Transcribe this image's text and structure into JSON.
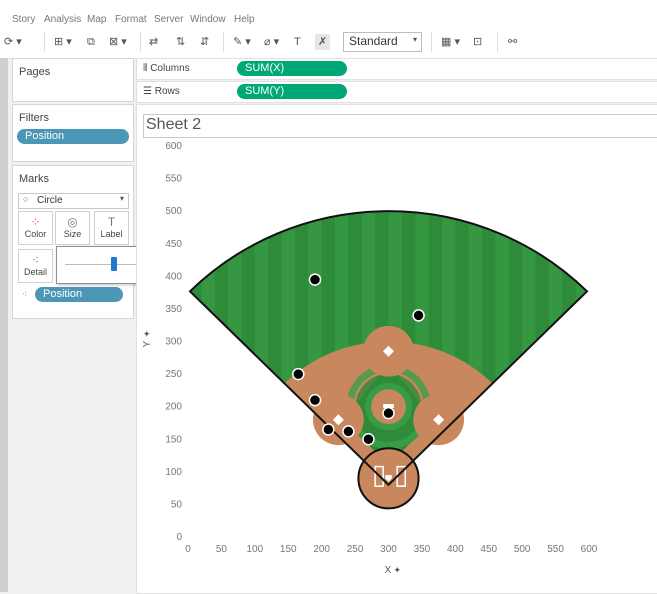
{
  "menu": [
    "Story",
    "Analysis",
    "Map",
    "Format",
    "Server",
    "Window",
    "Help"
  ],
  "toolbar": {
    "fit_select": "Standard"
  },
  "pages": {
    "title": "Pages"
  },
  "filters": {
    "title": "Filters",
    "pill": "Position"
  },
  "marks": {
    "title": "Marks",
    "type_select": "Circle",
    "buttons": [
      "Color",
      "Size",
      "Label",
      "Detail"
    ],
    "detail_pill": "Position",
    "size_slider_value": 0.45
  },
  "shelves": {
    "columns_label": "Columns",
    "columns_pill": "SUM(X)",
    "rows_label": "Rows",
    "rows_pill": "SUM(Y)"
  },
  "sheet": {
    "title": "Sheet 2"
  },
  "chart_data": {
    "type": "scatter",
    "xlabel": "X",
    "ylabel": "Y",
    "xlim": [
      0,
      600
    ],
    "ylim": [
      0,
      600
    ],
    "x_ticks": [
      "0",
      "50",
      "100",
      "150",
      "200",
      "250",
      "300",
      "350",
      "400",
      "450",
      "500",
      "550",
      "600"
    ],
    "y_ticks": [
      "0",
      "50",
      "100",
      "150",
      "200",
      "250",
      "300",
      "350",
      "400",
      "450",
      "500",
      "550",
      "600"
    ],
    "background_image": "baseball-field",
    "points": [
      {
        "x": 190,
        "y": 395
      },
      {
        "x": 345,
        "y": 340
      },
      {
        "x": 165,
        "y": 250
      },
      {
        "x": 190,
        "y": 210
      },
      {
        "x": 210,
        "y": 165
      },
      {
        "x": 240,
        "y": 162
      },
      {
        "x": 270,
        "y": 150
      },
      {
        "x": 300,
        "y": 190
      }
    ]
  }
}
